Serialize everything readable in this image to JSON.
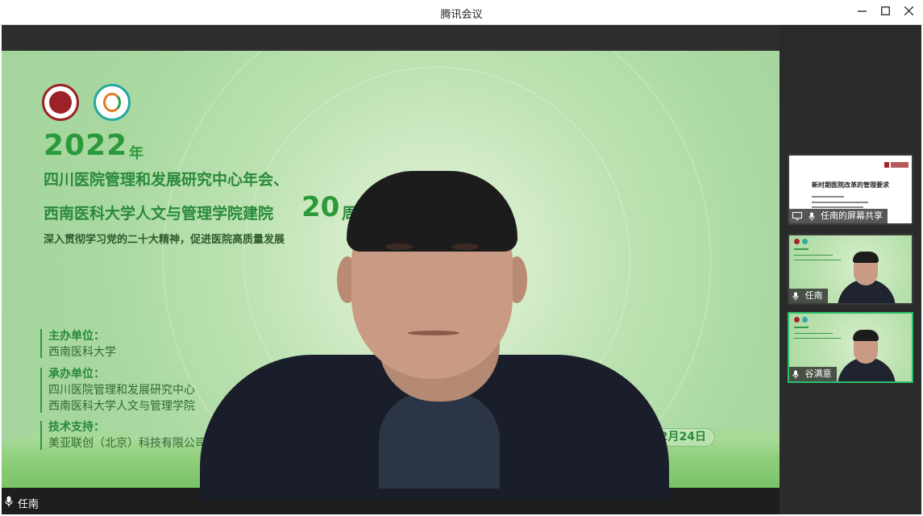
{
  "window": {
    "title": "腾讯会议"
  },
  "slide": {
    "year": "2022",
    "year_suffix": "年",
    "title_line1": "四川医院管理和发展研究中心年会、",
    "title_line2_prefix": "西南医科大学人文与管理学院建院",
    "title_line2_number": "20",
    "title_line2_suffix": "周",
    "subtitle": "深入贯彻学习党的二十大精神，促进医院高质量发展",
    "organizer_label": "主办单位：",
    "organizer": "西南医科大学",
    "co_organizer_label": "承办单位：",
    "co_organizer_1": "四川医院管理和发展研究中心",
    "co_organizer_2": "西南医科大学人文与管理学院",
    "tech_label": "技术支持：",
    "tech": "美亚联创（北京）科技有限公司",
    "date_fragment": "年12月24日"
  },
  "main_speaker": {
    "name": "任南",
    "mic_icon": "mic-icon"
  },
  "sidebar": {
    "share_tile": {
      "label": "任南的屏幕共享",
      "slide_title": "新时期医院改革的管理要求",
      "icon": "screen-share-icon"
    },
    "tiles": [
      {
        "name": "任南",
        "mic_icon": "mic-icon"
      },
      {
        "name": "谷满意",
        "mic_icon": "mic-icon"
      }
    ]
  },
  "colors": {
    "slide_green": "#a9d8a1",
    "title_green": "#2a9a3a",
    "active_speaker_border": "#2cc06a"
  }
}
